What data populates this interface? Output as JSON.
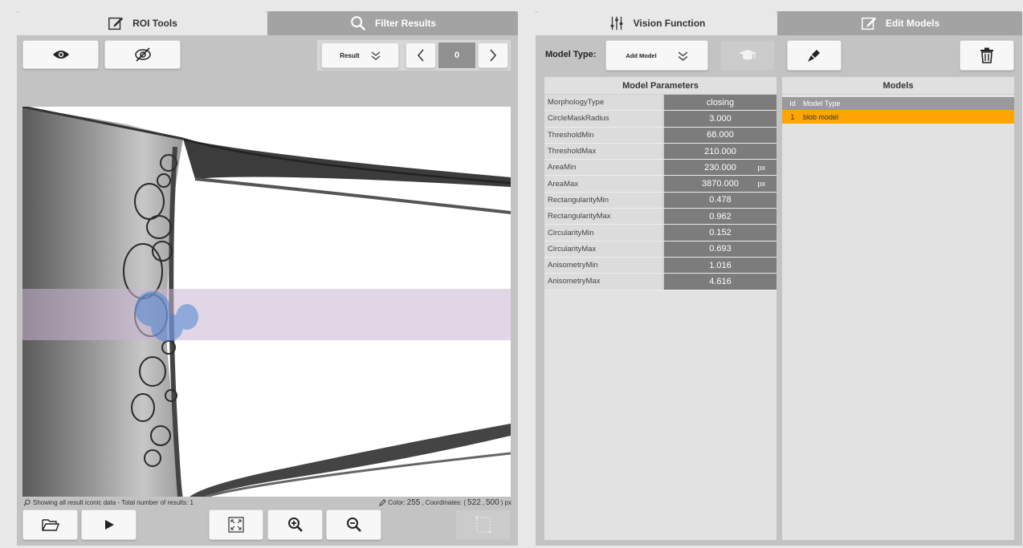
{
  "left_tabs": [
    {
      "label": "ROI Tools",
      "icon": "edit-icon"
    },
    {
      "label": "Filter Results",
      "icon": "search-icon"
    }
  ],
  "result_dropdown": {
    "label": "Result",
    "icon": "chevron-double-down-icon"
  },
  "result_index": "0",
  "status": {
    "message": "Showing all result iconic data - Total number of results: 1",
    "color_label": "Color:",
    "color_value": "255",
    "coordinates_label": ", Coordinates: (",
    "coord_x": "522",
    "coord_sep": ",",
    "coord_y": "500",
    "coord_unit": ") px"
  },
  "right_tabs": [
    {
      "label": "Vision Function",
      "icon": "sliders-icon"
    },
    {
      "label": "Edit Models",
      "icon": "edit-icon"
    }
  ],
  "model_type_label": "Model Type:",
  "add_model": {
    "label": "Add Model",
    "icon": "chevron-double-down-icon"
  },
  "model_parameters": {
    "title": "Model Parameters",
    "rows": [
      {
        "name": "MorphologyType",
        "value": "closing",
        "unit": ""
      },
      {
        "name": "CircleMaskRadius",
        "value": "3.000",
        "unit": ""
      },
      {
        "name": "ThresholdMin",
        "value": "68.000",
        "unit": ""
      },
      {
        "name": "ThresholdMax",
        "value": "210.000",
        "unit": ""
      },
      {
        "name": "AreaMin",
        "value": "230.000",
        "unit": "px"
      },
      {
        "name": "AreaMax",
        "value": "3870.000",
        "unit": "px"
      },
      {
        "name": "RectangularityMin",
        "value": "0.478",
        "unit": ""
      },
      {
        "name": "RectangularityMax",
        "value": "0.962",
        "unit": ""
      },
      {
        "name": "CircularityMin",
        "value": "0.152",
        "unit": ""
      },
      {
        "name": "CircularityMax",
        "value": "0.693",
        "unit": ""
      },
      {
        "name": "AnisometryMin",
        "value": "1.016",
        "unit": ""
      },
      {
        "name": "AnisometryMax",
        "value": "4.616",
        "unit": ""
      }
    ]
  },
  "models": {
    "title": "Models",
    "columns": [
      "Id",
      "Model Type"
    ],
    "rows": [
      {
        "id": "1",
        "type": "blob model"
      }
    ]
  },
  "colors": {
    "panel": "#c3c3c3",
    "active_tab": "#e8e8e8",
    "inactive_tab": "#a3a3a3",
    "selected_row": "#ffa500",
    "param_value_bg": "#7c7c7c",
    "roi_overlay": "#c8b4d2"
  }
}
